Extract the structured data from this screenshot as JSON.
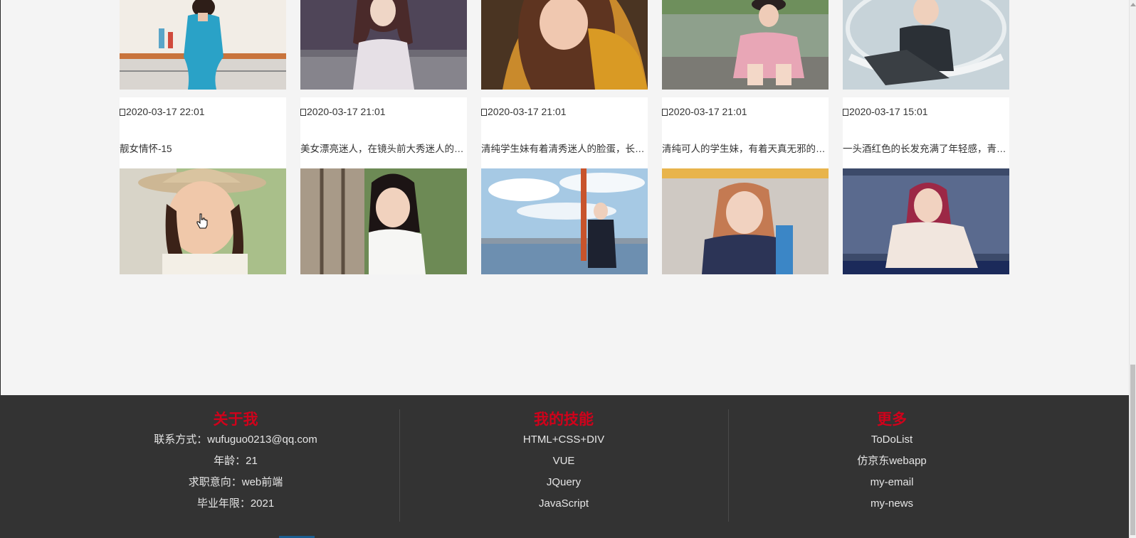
{
  "cards_row1": [
    {
      "date": "2020-03-17 22:01",
      "desc": "靓女情怀-15"
    },
    {
      "date": "2020-03-17 21:01",
      "desc": "美女漂亮迷人，在镜头前大秀迷人的身材，性感又迷人"
    },
    {
      "date": "2020-03-17 21:01",
      "desc": "清纯学生妹有着清秀迷人的脸蛋，长发飘飘"
    },
    {
      "date": "2020-03-17 21:01",
      "desc": "清纯可人的学生妹，有着天真无邪的笑容"
    },
    {
      "date": "2020-03-17 15:01",
      "desc": "一头酒红色的长发充满了年轻感，青春活力"
    }
  ],
  "colors": {
    "accent": "#d0021b",
    "footer_bg": "#333333",
    "page_bg": "#f4f4f4"
  },
  "footer": {
    "about": {
      "title": "关于我",
      "lines": [
        "联系方式：wufuguo0213@qq.com",
        "年龄：21",
        "求职意向：web前端",
        "毕业年限：2021"
      ]
    },
    "skills": {
      "title": "我的技能",
      "lines": [
        "HTML+CSS+DIV",
        "VUE",
        "JQuery",
        "JavaScript"
      ]
    },
    "more": {
      "title": "更多",
      "links": [
        "ToDoList",
        "仿京东webapp",
        "my-email",
        "my-news"
      ]
    }
  },
  "icons": {
    "date": "calendar-icon",
    "cursor": "hand-pointer-icon"
  }
}
